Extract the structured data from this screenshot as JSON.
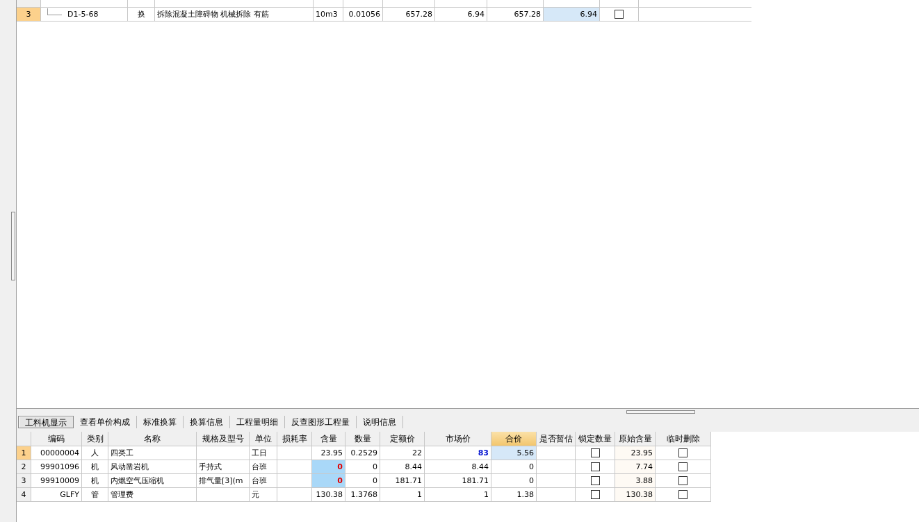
{
  "top_grid": {
    "rows": [
      {
        "row_no": "3",
        "code": "D1-5-68",
        "type": "换",
        "name": "拆除混凝土障碍物 机械拆除 有筋",
        "unit": "10m3",
        "quantity": "0.01056",
        "col_7": "657.28",
        "col_8": "6.94",
        "col_9": "657.28",
        "col_10": "6.94",
        "checked": false,
        "selected": true
      }
    ]
  },
  "tabs": [
    {
      "label": "工料机显示",
      "selected": true
    },
    {
      "label": "查看单价构成",
      "selected": false
    },
    {
      "label": "标准换算",
      "selected": false
    },
    {
      "label": "换算信息",
      "selected": false
    },
    {
      "label": "工程量明细",
      "selected": false
    },
    {
      "label": "反查图形工程量",
      "selected": false
    },
    {
      "label": "说明信息",
      "selected": false
    }
  ],
  "table": {
    "columns": [
      {
        "label": "编码",
        "sorted": false
      },
      {
        "label": "类别",
        "sorted": false
      },
      {
        "label": "名称",
        "sorted": false
      },
      {
        "label": "规格及型号",
        "sorted": false
      },
      {
        "label": "单位",
        "sorted": false
      },
      {
        "label": "损耗率",
        "sorted": false
      },
      {
        "label": "含量",
        "sorted": false
      },
      {
        "label": "数量",
        "sorted": false
      },
      {
        "label": "定额价",
        "sorted": false
      },
      {
        "label": "市场价",
        "sorted": false
      },
      {
        "label": "合价",
        "sorted": true
      },
      {
        "label": "是否暂估",
        "sorted": false
      },
      {
        "label": "锁定数量",
        "sorted": false
      },
      {
        "label": "原始含量",
        "sorted": false
      },
      {
        "label": "临时删除",
        "sorted": false
      }
    ],
    "rows": [
      {
        "row_no": "1",
        "code": "00000004",
        "type": "人",
        "name": "四类工",
        "unit": "工日",
        "content": "23.95",
        "quantity": "0.2529",
        "base_price": "22",
        "market_price": "83",
        "total": "5.56",
        "locked": false,
        "original": "23.95",
        "deleted": false,
        "selected": true,
        "content_changed": false,
        "price_changed": true
      },
      {
        "row_no": "2",
        "code": "99901096",
        "type": "机",
        "name": "风动凿岩机",
        "spec": "手持式",
        "unit": "台班",
        "content": "0",
        "quantity": "0",
        "base_price": "8.44",
        "market_price": "8.44",
        "total": "0",
        "locked": false,
        "original": "7.74",
        "deleted": false,
        "selected": false,
        "content_changed": true,
        "price_changed": false
      },
      {
        "row_no": "3",
        "code": "99910009",
        "type": "机",
        "name": "内燃空气压缩机",
        "spec": "排气量[3](m",
        "unit": "台班",
        "content": "0",
        "quantity": "0",
        "base_price": "181.71",
        "market_price": "181.71",
        "total": "0",
        "locked": false,
        "original": "3.88",
        "deleted": false,
        "selected": false,
        "content_changed": true,
        "price_changed": false
      },
      {
        "row_no": "4",
        "code": "GLFY",
        "type": "管",
        "name": "管理费",
        "unit": "元",
        "content": "130.38",
        "quantity": "1.3768",
        "base_price": "1",
        "market_price": "1",
        "total": "1.38",
        "locked": false,
        "original": "130.38",
        "deleted": false,
        "selected": false,
        "content_changed": false,
        "price_changed": false
      }
    ]
  }
}
